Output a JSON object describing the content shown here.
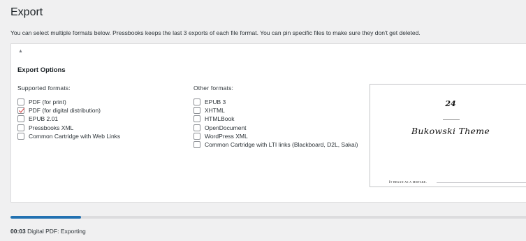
{
  "page": {
    "title": "Export",
    "intro": "You can select multiple formats below. Pressbooks keeps the last 3 exports of each file format. You can pin specific files to make sure they don't get deleted."
  },
  "panel": {
    "toggle_glyph": "▲",
    "options_heading": "Export Options"
  },
  "supported": {
    "heading": "Supported formats:",
    "items": [
      {
        "label": "PDF (for print)",
        "checked": false
      },
      {
        "label": "PDF (for digital distribution)",
        "checked": true
      },
      {
        "label": "EPUB 2.01",
        "checked": false
      },
      {
        "label": "Pressbooks XML",
        "checked": false
      },
      {
        "label": "Common Cartridge with Web Links",
        "checked": false
      }
    ]
  },
  "other": {
    "heading": "Other formats:",
    "items": [
      {
        "label": "EPUB 3",
        "checked": false
      },
      {
        "label": "XHTML",
        "checked": false
      },
      {
        "label": "HTMLBook",
        "checked": false
      },
      {
        "label": "OpenDocument",
        "checked": false
      },
      {
        "label": "WordPress XML",
        "checked": false
      },
      {
        "label": "Common Cartridge with LTI links (Blackboard, D2L, Sakai)",
        "checked": false
      }
    ]
  },
  "preview": {
    "number": "24",
    "theme_title": "Bukowski Theme",
    "footer_text": "It began as a mistake."
  },
  "progress": {
    "fraction": 0.135,
    "time": "00:03",
    "message": "Digital PDF: Exporting"
  },
  "colors": {
    "accent": "#2271b1",
    "check": "#d63638"
  }
}
